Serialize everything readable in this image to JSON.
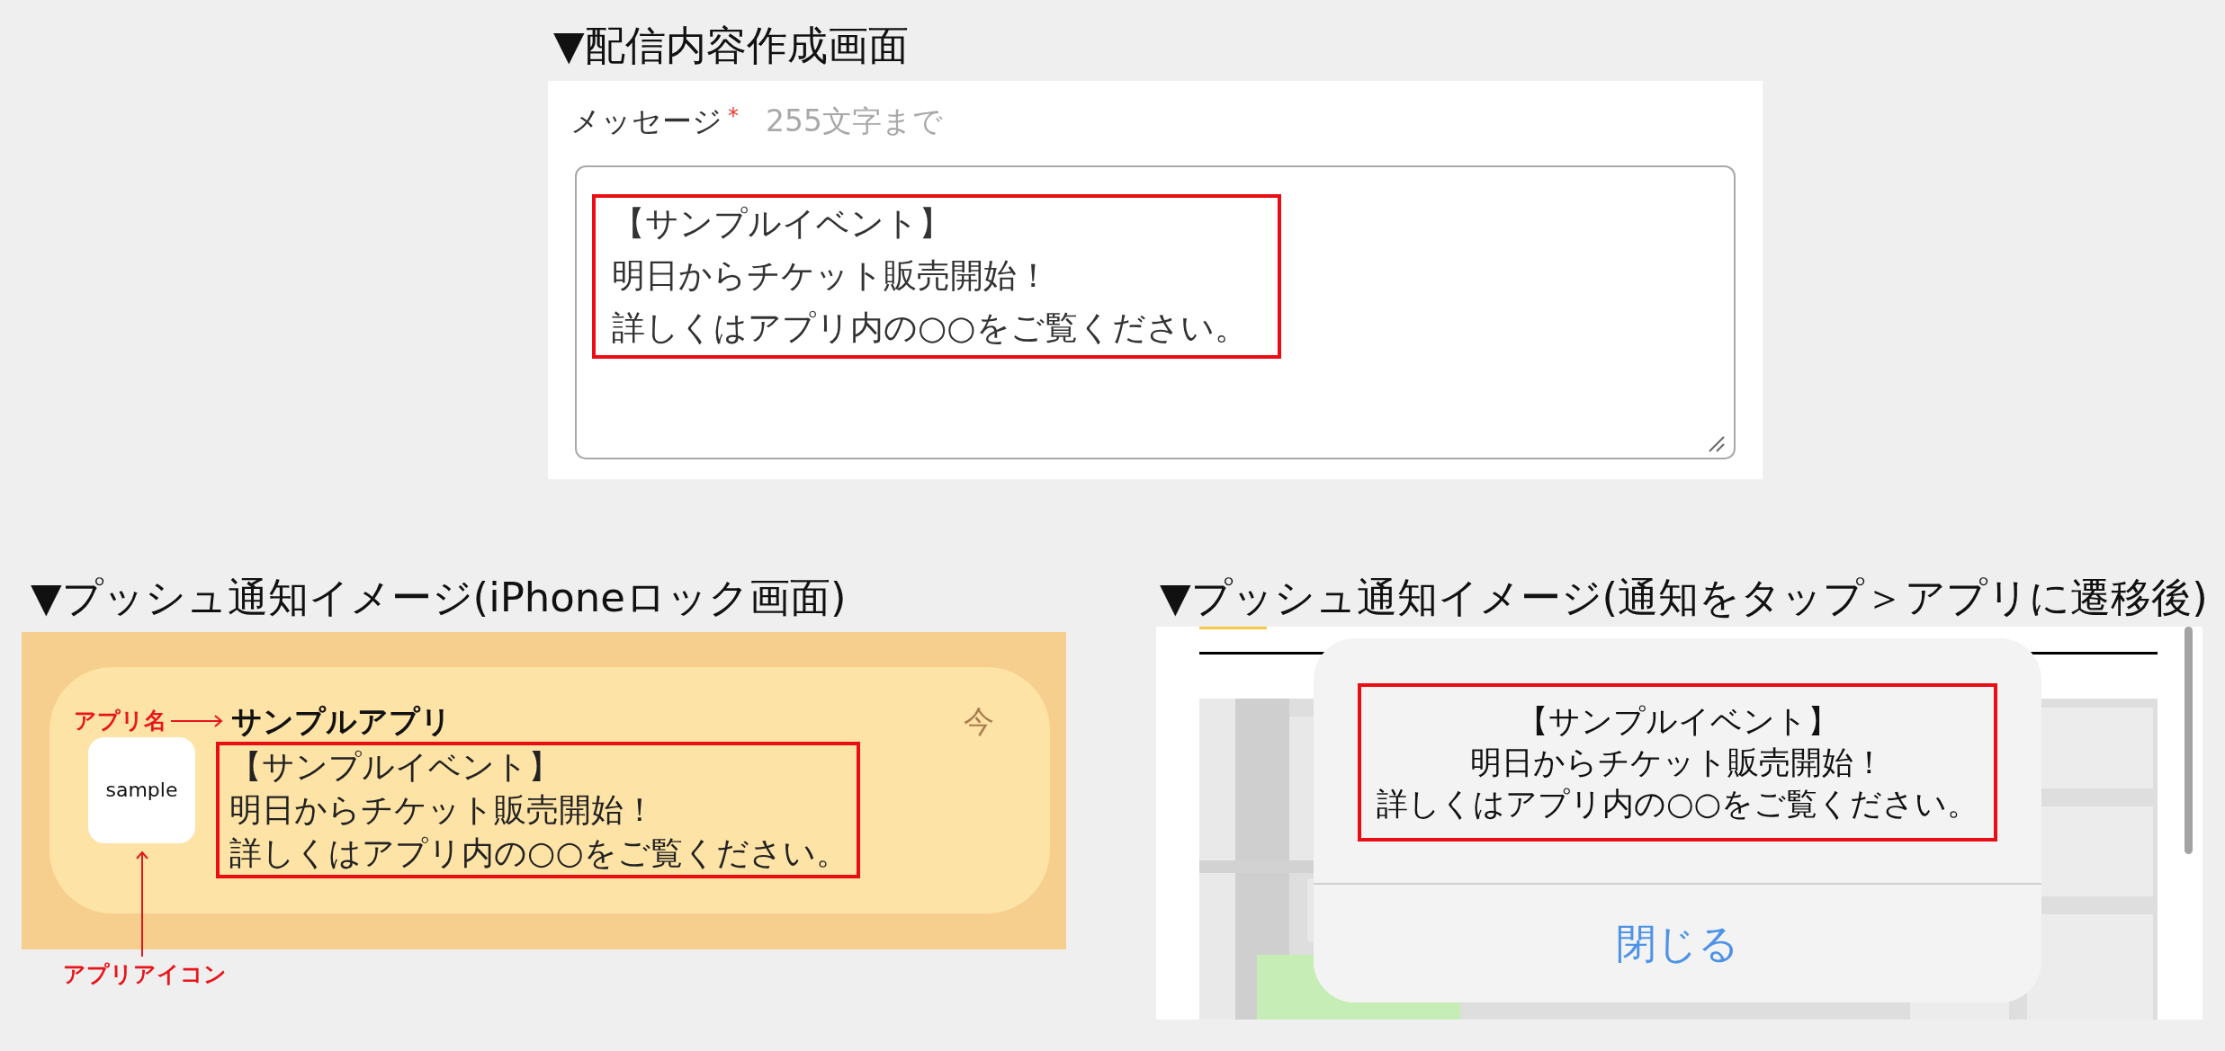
{
  "compose": {
    "title": "▼配信内容作成画面",
    "label": "メッセージ",
    "required_mark": "*",
    "hint": "255文字まで",
    "value_lines": [
      "【サンプルイベント】",
      "明日からチケット販売開始！",
      "詳しくはアプリ内の○○をご覧ください。"
    ]
  },
  "lock_screen_preview": {
    "title": "▼プッシュ通知イメージ(iPhoneロック画面)",
    "app_name_note": "アプリ名",
    "app_icon_note": "アプリアイコン",
    "notification": {
      "app_name": "サンプルアプリ",
      "time": "今",
      "icon_text": "sample",
      "message_lines": [
        "【サンプルイベント】",
        "明日からチケット販売開始！",
        "詳しくはアプリ内の○○をご覧ください。"
      ]
    }
  },
  "in_app_preview": {
    "title": "▼プッシュ通知イメージ(通知をタップ＞アプリに遷移後)",
    "alert": {
      "message_lines": [
        "【サンプルイベント】",
        "明日からチケット販売開始！",
        "詳しくはアプリ内の○○をご覧ください。"
      ],
      "close_button": "閉じる"
    }
  }
}
